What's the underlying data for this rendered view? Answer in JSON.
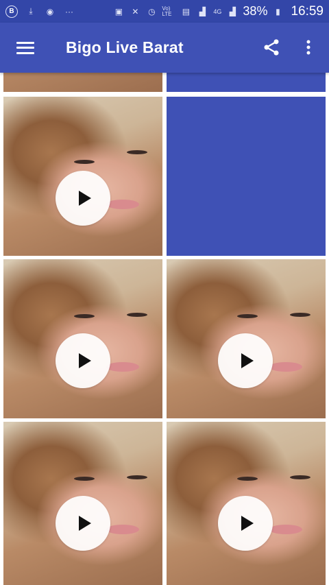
{
  "status_bar": {
    "left_icons": [
      "b-badge-icon",
      "download-icon",
      "hotspot-icon",
      "more-dots-icon"
    ],
    "volte": "Vo) LTE",
    "network": "4G",
    "battery_percent": "38%",
    "time": "16:59"
  },
  "app_bar": {
    "title": "Bigo Live Barat",
    "menu_icon": "hamburger-menu-icon",
    "share_icon": "share-icon",
    "overflow_icon": "more-vert-icon",
    "color": "#3f51b5"
  },
  "grid": {
    "tiles": [
      {
        "type": "video",
        "icon": "play-icon"
      },
      {
        "type": "placeholder"
      },
      {
        "type": "video",
        "icon": "play-icon"
      },
      {
        "type": "placeholder"
      },
      {
        "type": "video",
        "icon": "play-icon"
      },
      {
        "type": "video",
        "icon": "play-icon"
      },
      {
        "type": "video",
        "icon": "play-icon"
      },
      {
        "type": "video",
        "icon": "play-icon"
      }
    ]
  }
}
